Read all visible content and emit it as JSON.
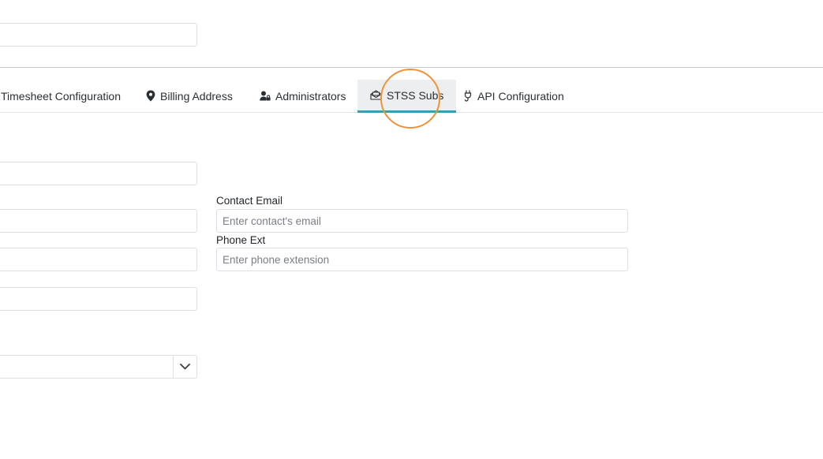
{
  "tabs": [
    {
      "label": "Timesheet Configuration",
      "icon": "",
      "active": false
    },
    {
      "label": "Billing Address",
      "icon": "map-pin-icon",
      "active": false
    },
    {
      "label": "Administrators",
      "icon": "user-lock-icon",
      "active": false
    },
    {
      "label": "STSS Subs",
      "icon": "envelope-open-icon",
      "active": true
    },
    {
      "label": "API Configuration",
      "icon": "plug-icon",
      "active": false
    }
  ],
  "form": {
    "contact_email_label": "Contact Email",
    "contact_email_placeholder": "Enter contact's email",
    "phone_ext_label": "Phone Ext",
    "phone_ext_placeholder": "Enter phone extension"
  },
  "colors": {
    "active_tab_underline": "#3d9cb0",
    "active_tab_bg": "#eceeef",
    "highlight_ring": "#f0923a"
  }
}
